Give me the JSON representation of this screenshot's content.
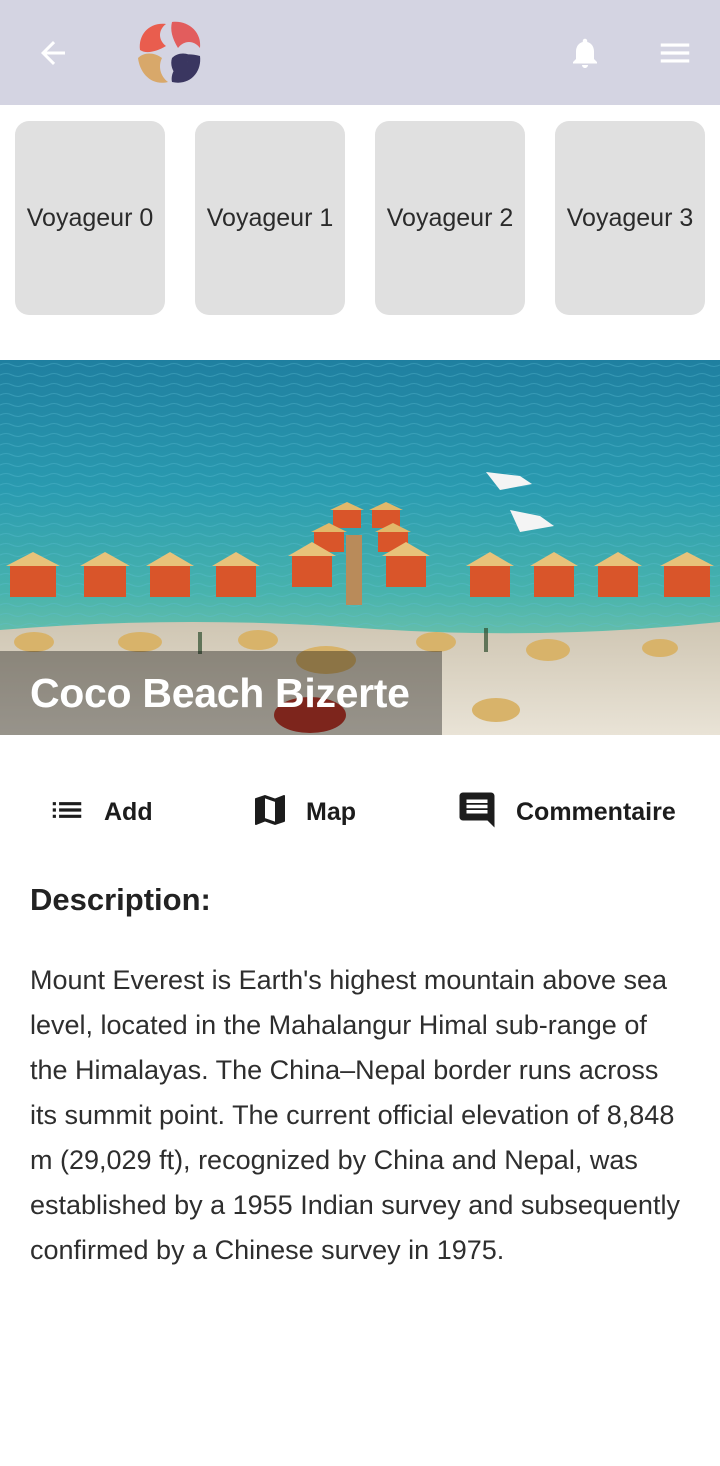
{
  "header": {
    "back_icon": "arrow-left-icon",
    "logo": "app-logo",
    "notification_icon": "bell-icon",
    "menu_icon": "hamburger-menu-icon",
    "background_color": "#d4d4e2"
  },
  "travelers": [
    {
      "label": "Voyageur 0"
    },
    {
      "label": "Voyageur 1"
    },
    {
      "label": "Voyageur 2"
    },
    {
      "label": "Voyageur 3"
    }
  ],
  "hero": {
    "title": "Coco Beach Bizerte"
  },
  "actions": [
    {
      "label": "Add",
      "icon": "list-icon"
    },
    {
      "label": "Map",
      "icon": "map-icon"
    },
    {
      "label": "Commentaire",
      "icon": "comment-icon"
    }
  ],
  "description": {
    "heading": "Description:",
    "body": "Mount Everest is Earth's highest mountain above sea level, located in the Mahalangur Himal sub-range of the Himalayas. The China–Nepal border runs across its summit point. The current official elevation of 8,848 m (29,029 ft), recognized by China and Nepal, was established by a 1955 Indian survey and subsequently confirmed by a Chinese survey in 1975."
  }
}
